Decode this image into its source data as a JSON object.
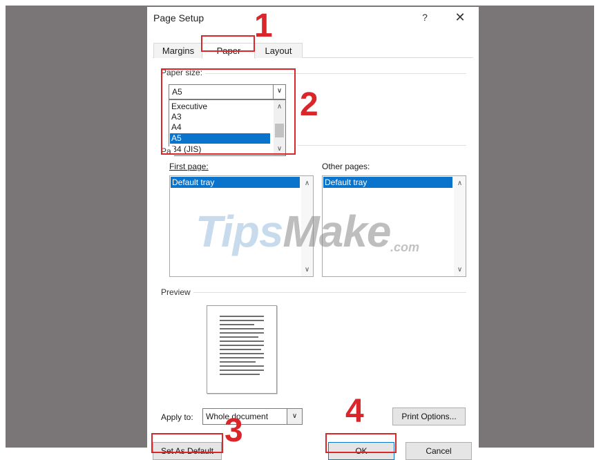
{
  "dialog": {
    "title": "Page Setup",
    "help_label": "?",
    "close_label": "✕"
  },
  "tabs": [
    {
      "label": "Margins",
      "active": false
    },
    {
      "label": "Paper",
      "active": true
    },
    {
      "label": "Layout",
      "active": false
    }
  ],
  "paper_size": {
    "label": "Paper size:",
    "selected": "A5",
    "options": [
      "Executive",
      "A3",
      "A4",
      "A5",
      "B4 (JIS)"
    ],
    "highlighted_option": "A5"
  },
  "paper_source": {
    "label_visible_fragment": "Pa",
    "first_page": {
      "label": "First page:",
      "items": [
        "Default tray"
      ],
      "selected": "Default tray"
    },
    "other_pages": {
      "label": "Other pages:",
      "items": [
        "Default tray"
      ],
      "selected": "Default tray"
    }
  },
  "preview": {
    "label": "Preview"
  },
  "apply_to": {
    "label": "Apply to:",
    "value": "Whole document"
  },
  "buttons": {
    "print_options": "Print Options...",
    "set_as_default": "Set As Default",
    "ok": "OK",
    "cancel": "Cancel"
  },
  "annotations": {
    "step1": "1",
    "step2": "2",
    "step3": "3",
    "step4": "4",
    "color": "#d9262b"
  },
  "watermark": {
    "brand_tips": "Tips",
    "brand_make": "Make",
    "suffix": ".com"
  },
  "icons": {
    "combo_arrow": "chevron-down-icon",
    "scroll_up": "chevron-up-icon",
    "scroll_down": "chevron-down-icon"
  }
}
